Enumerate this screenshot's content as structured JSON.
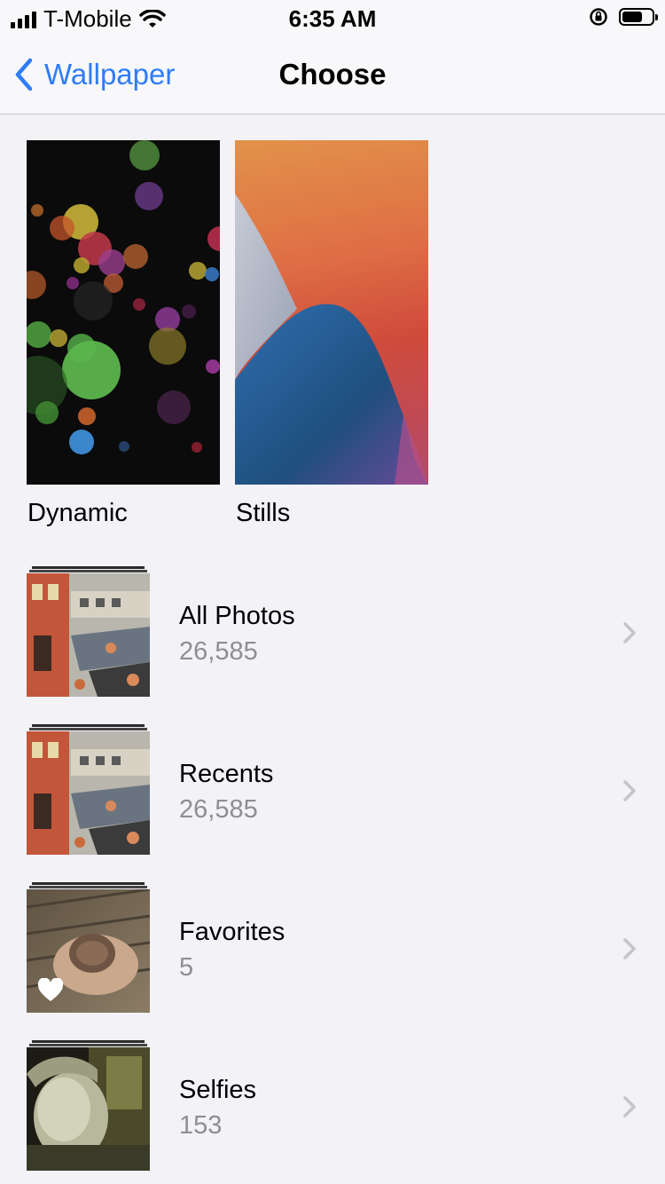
{
  "status_bar": {
    "carrier": "T-Mobile",
    "time": "6:35 AM"
  },
  "nav": {
    "back_label": "Wallpaper",
    "title": "Choose"
  },
  "wallpapers": [
    {
      "label": "Dynamic"
    },
    {
      "label": "Stills"
    }
  ],
  "albums": [
    {
      "name": "All Photos",
      "count": "26,585"
    },
    {
      "name": "Recents",
      "count": "26,585"
    },
    {
      "name": "Favorites",
      "count": "5"
    },
    {
      "name": "Selfies",
      "count": "153"
    }
  ],
  "colors": {
    "accent": "#2f7cf6",
    "background": "#f2f2f7",
    "secondary_text": "#8e8e93"
  }
}
